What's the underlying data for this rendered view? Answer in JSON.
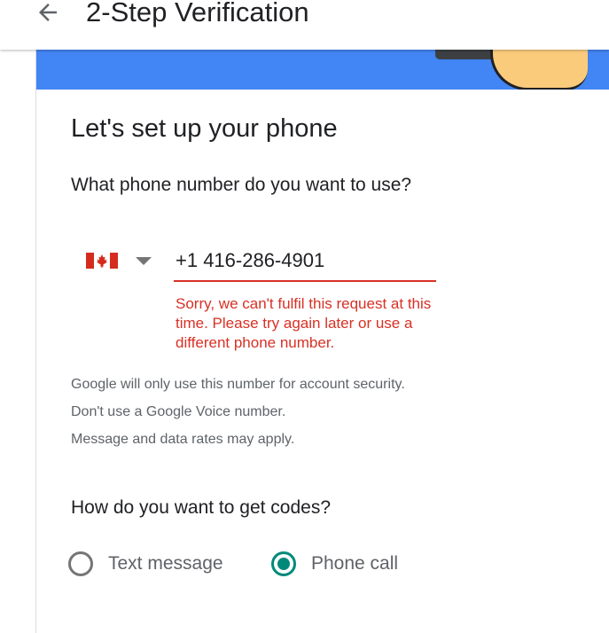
{
  "appbar": {
    "title": "2-Step Verification",
    "back_icon": "arrow-back-icon"
  },
  "banner": {
    "color": "#4285f4"
  },
  "setup": {
    "heading": "Let's set up your phone",
    "question": "What phone number do you want to use?",
    "country": {
      "flag_icon": "canada-flag-icon",
      "dropdown_icon": "dropdown-caret-icon"
    },
    "phone": {
      "value": "+1 416-286-4901"
    },
    "error": "Sorry, we can't fulfil this request at this time. Please try again later or use a different phone number.",
    "info_lines": [
      "Google will only use this number for account security.",
      "Don't use a Google Voice number.",
      "Message and data rates may apply."
    ],
    "codes_question": "How do you want to get codes?",
    "options": [
      {
        "label": "Text message",
        "selected": false
      },
      {
        "label": "Phone call",
        "selected": true
      }
    ]
  },
  "colors": {
    "accent": "#00897b",
    "error": "#d93025",
    "brand_blue": "#4285f4"
  }
}
